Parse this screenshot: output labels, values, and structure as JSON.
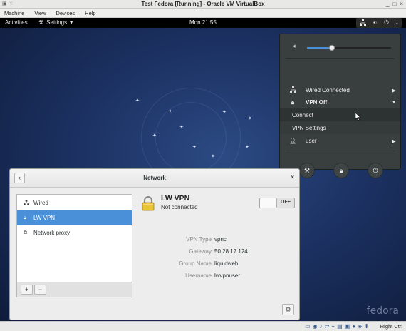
{
  "vbox": {
    "title": "Test Fedora [Running] - Oracle VM VirtualBox",
    "menu": [
      "Machine",
      "View",
      "Devices",
      "Help"
    ],
    "window_buttons": [
      "_",
      "□",
      "×"
    ],
    "host_key": "Right Ctrl"
  },
  "topbar": {
    "activities": "Activities",
    "app_menu": "Settings",
    "clock": "Mon 21:55"
  },
  "system_menu": {
    "volume_level": 0.3,
    "items": {
      "wired": "Wired Connected",
      "vpn": "VPN Off",
      "connect": "Connect",
      "vpn_settings": "VPN Settings",
      "user": "user"
    }
  },
  "network_dialog": {
    "title": "Network",
    "list": [
      "Wired",
      "LW VPN",
      "Network proxy"
    ],
    "add": "+",
    "remove": "−",
    "vpn": {
      "name": "LW VPN",
      "status": "Not connected",
      "toggle": "OFF",
      "properties": [
        {
          "label": "VPN Type",
          "value": "vpnc"
        },
        {
          "label": "Gateway",
          "value": "50.28.17.124"
        },
        {
          "label": "Group Name",
          "value": "liquidweb"
        },
        {
          "label": "Username",
          "value": "lwvpnuser"
        }
      ]
    }
  },
  "desktop": {
    "watermark": "fedora"
  },
  "colors": {
    "accent": "#4a90d9",
    "popover": "#393f3f",
    "topbar": "#000000"
  }
}
